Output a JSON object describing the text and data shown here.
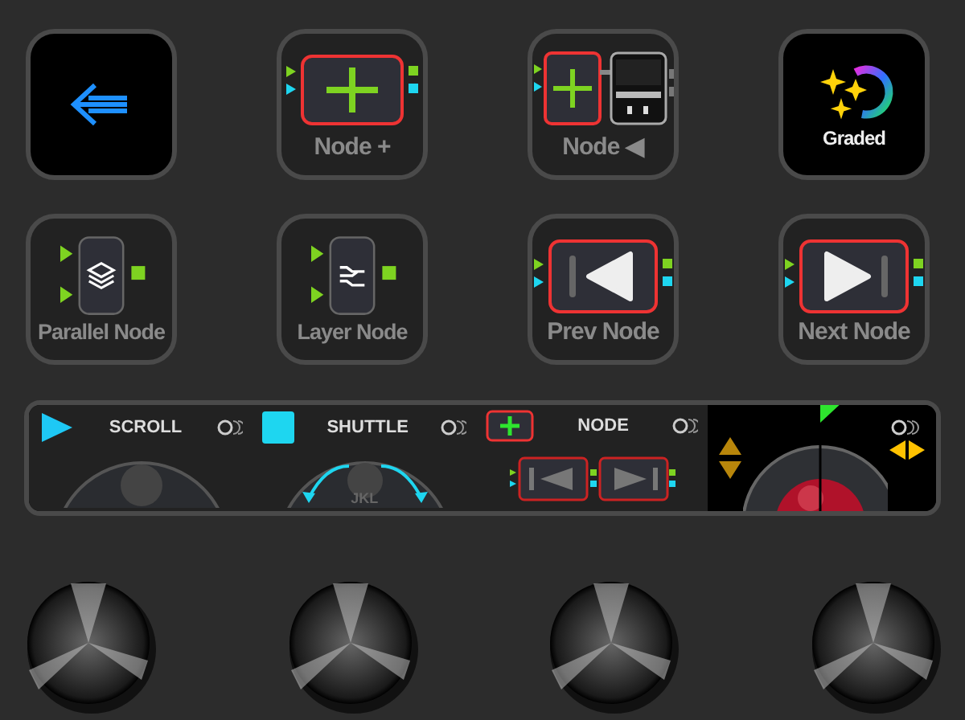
{
  "buttons": [
    {
      "kind": "back"
    },
    {
      "kind": "node-add",
      "label": "Node +"
    },
    {
      "kind": "node-viewer",
      "label": "Node ◀"
    },
    {
      "kind": "graded",
      "label": "Graded"
    },
    {
      "kind": "parallel",
      "label": "Parallel Node"
    },
    {
      "kind": "layer",
      "label": "Layer Node"
    },
    {
      "kind": "prev",
      "label": "Prev Node"
    },
    {
      "kind": "next",
      "label": "Next Node"
    }
  ],
  "strip": {
    "scroll": {
      "label": "SCROLL"
    },
    "shuttle": {
      "label": "SHUTTLE",
      "dial_label": "JKL"
    },
    "node": {
      "label": "NODE"
    }
  }
}
